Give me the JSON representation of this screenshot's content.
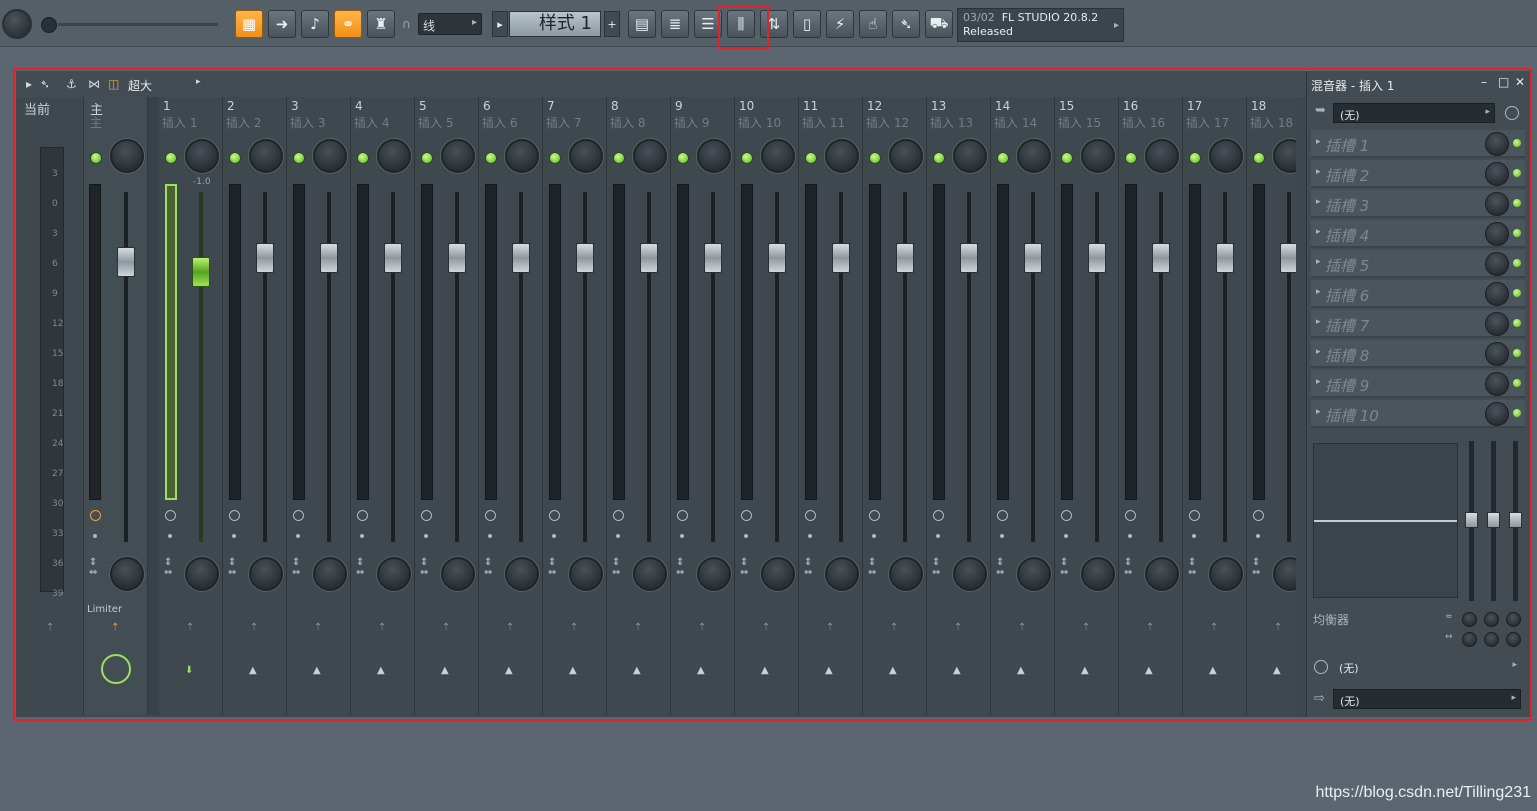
{
  "toolbar": {
    "linemode": "线",
    "pattern": "样式 1",
    "news_date": "03/02",
    "news_version": "FL STUDIO 20.8.2",
    "news_status": "Released",
    "accent": "#f5a025"
  },
  "mixer": {
    "mode": "超大",
    "current_label": "当前",
    "master_num": "主",
    "master_name": "主",
    "master_fx": "Limiter",
    "scale": [
      "3",
      "0",
      "3",
      "6",
      "9",
      "12",
      "15",
      "18",
      "21",
      "24",
      "27",
      "30",
      "33",
      "36",
      "39"
    ],
    "selected_db": "-1.0",
    "inserts": [
      {
        "num": "1",
        "name": "插入 1"
      },
      {
        "num": "2",
        "name": "插入 2"
      },
      {
        "num": "3",
        "name": "插入 3"
      },
      {
        "num": "4",
        "name": "插入 4"
      },
      {
        "num": "5",
        "name": "插入 5"
      },
      {
        "num": "6",
        "name": "插入 6"
      },
      {
        "num": "7",
        "name": "插入 7"
      },
      {
        "num": "8",
        "name": "插入 8"
      },
      {
        "num": "9",
        "name": "插入 9"
      },
      {
        "num": "10",
        "name": "插入 10"
      },
      {
        "num": "11",
        "name": "插入 11"
      },
      {
        "num": "12",
        "name": "插入 12"
      },
      {
        "num": "13",
        "name": "插入 13"
      },
      {
        "num": "14",
        "name": "插入 14"
      },
      {
        "num": "15",
        "name": "插入 15"
      },
      {
        "num": "16",
        "name": "插入 16"
      },
      {
        "num": "17",
        "name": "插入 17"
      },
      {
        "num": "18",
        "name": "插入 18"
      }
    ]
  },
  "panel": {
    "title": "混音器 - 插入 1",
    "input": "(无)",
    "slots": [
      "插槽 1",
      "插槽 2",
      "插槽 3",
      "插槽 4",
      "插槽 5",
      "插槽 6",
      "插槽 7",
      "插槽 8",
      "插槽 9",
      "插槽 10"
    ],
    "eq_label": "均衡器",
    "latency": "(无)",
    "output": "(无)"
  },
  "watermark": "https://blog.csdn.net/Tilling231"
}
